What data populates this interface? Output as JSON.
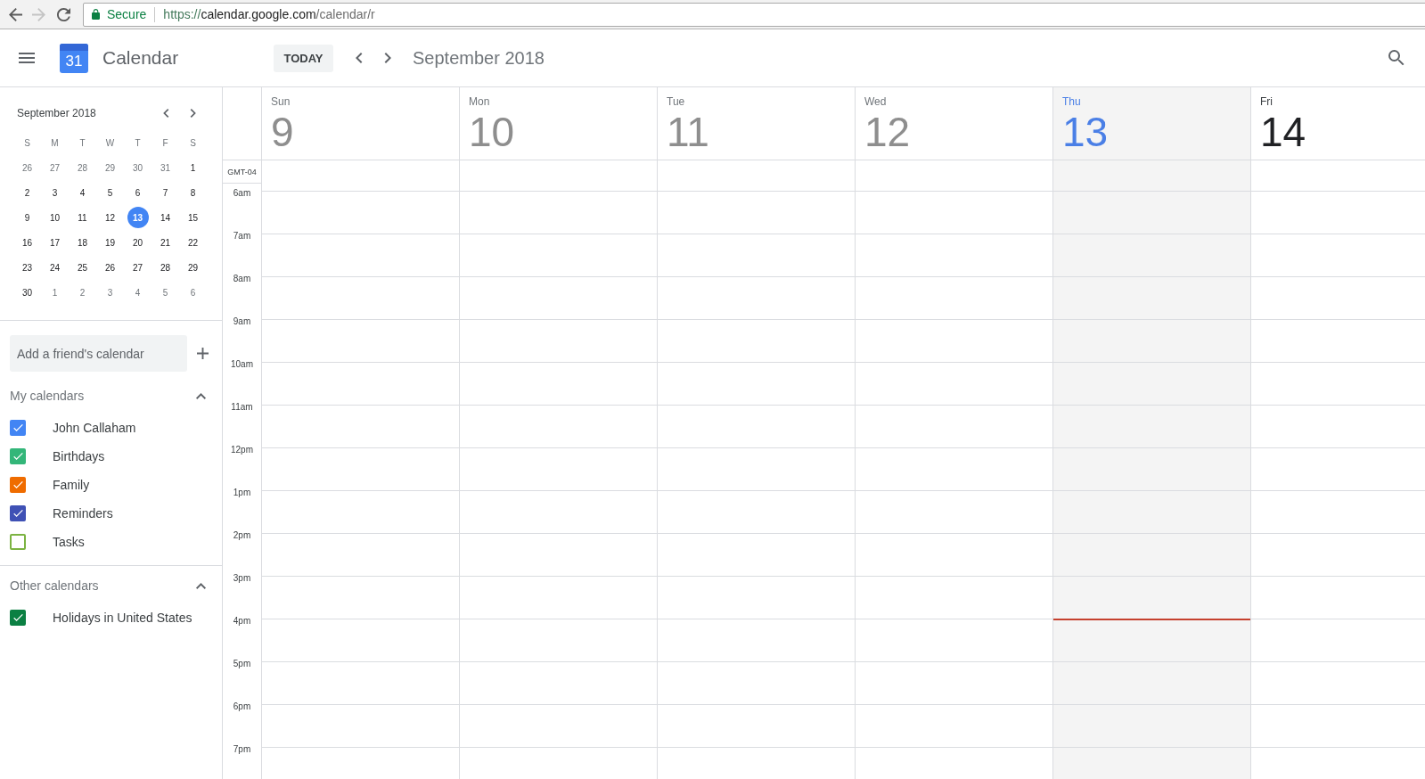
{
  "browser": {
    "back": {
      "disabled": false
    },
    "forward": {
      "disabled": true
    },
    "security": "Secure",
    "url": {
      "scheme": "https://",
      "host": "calendar.google.com",
      "path": "/calendar/r"
    }
  },
  "header": {
    "logo_text": "31",
    "app_name": "Calendar",
    "today_button": "TODAY",
    "period": "September 2018"
  },
  "mini_calendar": {
    "title": "September 2018",
    "weekdays": [
      "S",
      "M",
      "T",
      "W",
      "T",
      "F",
      "S"
    ],
    "weeks": [
      [
        {
          "label": "26",
          "outside": true,
          "selected": false
        },
        {
          "label": "27",
          "outside": true,
          "selected": false
        },
        {
          "label": "28",
          "outside": true,
          "selected": false
        },
        {
          "label": "29",
          "outside": true,
          "selected": false
        },
        {
          "label": "30",
          "outside": true,
          "selected": false
        },
        {
          "label": "31",
          "outside": true,
          "selected": false
        },
        {
          "label": "1",
          "outside": false,
          "selected": false
        }
      ],
      [
        {
          "label": "2",
          "outside": false,
          "selected": false
        },
        {
          "label": "3",
          "outside": false,
          "selected": false
        },
        {
          "label": "4",
          "outside": false,
          "selected": false
        },
        {
          "label": "5",
          "outside": false,
          "selected": false
        },
        {
          "label": "6",
          "outside": false,
          "selected": false
        },
        {
          "label": "7",
          "outside": false,
          "selected": false
        },
        {
          "label": "8",
          "outside": false,
          "selected": false
        }
      ],
      [
        {
          "label": "9",
          "outside": false,
          "selected": false
        },
        {
          "label": "10",
          "outside": false,
          "selected": false
        },
        {
          "label": "11",
          "outside": false,
          "selected": false
        },
        {
          "label": "12",
          "outside": false,
          "selected": false
        },
        {
          "label": "13",
          "outside": false,
          "selected": true
        },
        {
          "label": "14",
          "outside": false,
          "selected": false
        },
        {
          "label": "15",
          "outside": false,
          "selected": false
        }
      ],
      [
        {
          "label": "16",
          "outside": false,
          "selected": false
        },
        {
          "label": "17",
          "outside": false,
          "selected": false
        },
        {
          "label": "18",
          "outside": false,
          "selected": false
        },
        {
          "label": "19",
          "outside": false,
          "selected": false
        },
        {
          "label": "20",
          "outside": false,
          "selected": false
        },
        {
          "label": "21",
          "outside": false,
          "selected": false
        },
        {
          "label": "22",
          "outside": false,
          "selected": false
        }
      ],
      [
        {
          "label": "23",
          "outside": false,
          "selected": false
        },
        {
          "label": "24",
          "outside": false,
          "selected": false
        },
        {
          "label": "25",
          "outside": false,
          "selected": false
        },
        {
          "label": "26",
          "outside": false,
          "selected": false
        },
        {
          "label": "27",
          "outside": false,
          "selected": false
        },
        {
          "label": "28",
          "outside": false,
          "selected": false
        },
        {
          "label": "29",
          "outside": false,
          "selected": false
        }
      ],
      [
        {
          "label": "30",
          "outside": false,
          "selected": false
        },
        {
          "label": "1",
          "outside": true,
          "selected": false
        },
        {
          "label": "2",
          "outside": true,
          "selected": false
        },
        {
          "label": "3",
          "outside": true,
          "selected": false
        },
        {
          "label": "4",
          "outside": true,
          "selected": false
        },
        {
          "label": "5",
          "outside": true,
          "selected": false
        },
        {
          "label": "6",
          "outside": true,
          "selected": false
        }
      ]
    ]
  },
  "add_calendar": {
    "placeholder": "Add a friend's calendar"
  },
  "calendar_groups": [
    {
      "title": "My calendars",
      "expanded": true,
      "items": [
        {
          "name": "John Callaham",
          "checked": true,
          "color": "#4285f4"
        },
        {
          "name": "Birthdays",
          "checked": true,
          "color": "#33b679"
        },
        {
          "name": "Family",
          "checked": true,
          "color": "#ef6c00"
        },
        {
          "name": "Reminders",
          "checked": true,
          "color": "#3f51b5"
        },
        {
          "name": "Tasks",
          "checked": false,
          "color": "#7cb342"
        }
      ]
    },
    {
      "title": "Other calendars",
      "expanded": true,
      "items": [
        {
          "name": "Holidays in United States",
          "checked": true,
          "color": "#0b8043"
        }
      ]
    }
  ],
  "week": {
    "timezone": "GMT-04",
    "days": [
      {
        "weekday": "Sun",
        "date": "9",
        "past": true,
        "today": false
      },
      {
        "weekday": "Mon",
        "date": "10",
        "past": true,
        "today": false
      },
      {
        "weekday": "Tue",
        "date": "11",
        "past": true,
        "today": false
      },
      {
        "weekday": "Wed",
        "date": "12",
        "past": true,
        "today": false
      },
      {
        "weekday": "Thu",
        "date": "13",
        "past": false,
        "today": true
      },
      {
        "weekday": "Fri",
        "date": "14",
        "past": false,
        "today": false
      }
    ],
    "hours": [
      {
        "label": "6am",
        "now": false
      },
      {
        "label": "7am",
        "now": false
      },
      {
        "label": "8am",
        "now": false
      },
      {
        "label": "9am",
        "now": false
      },
      {
        "label": "10am",
        "now": false
      },
      {
        "label": "11am",
        "now": false
      },
      {
        "label": "12pm",
        "now": false
      },
      {
        "label": "1pm",
        "now": false
      },
      {
        "label": "2pm",
        "now": false
      },
      {
        "label": "3pm",
        "now": false
      },
      {
        "label": "4pm",
        "now": true
      },
      {
        "label": "5pm",
        "now": false
      },
      {
        "label": "6pm",
        "now": false
      },
      {
        "label": "7pm",
        "now": false
      }
    ]
  }
}
